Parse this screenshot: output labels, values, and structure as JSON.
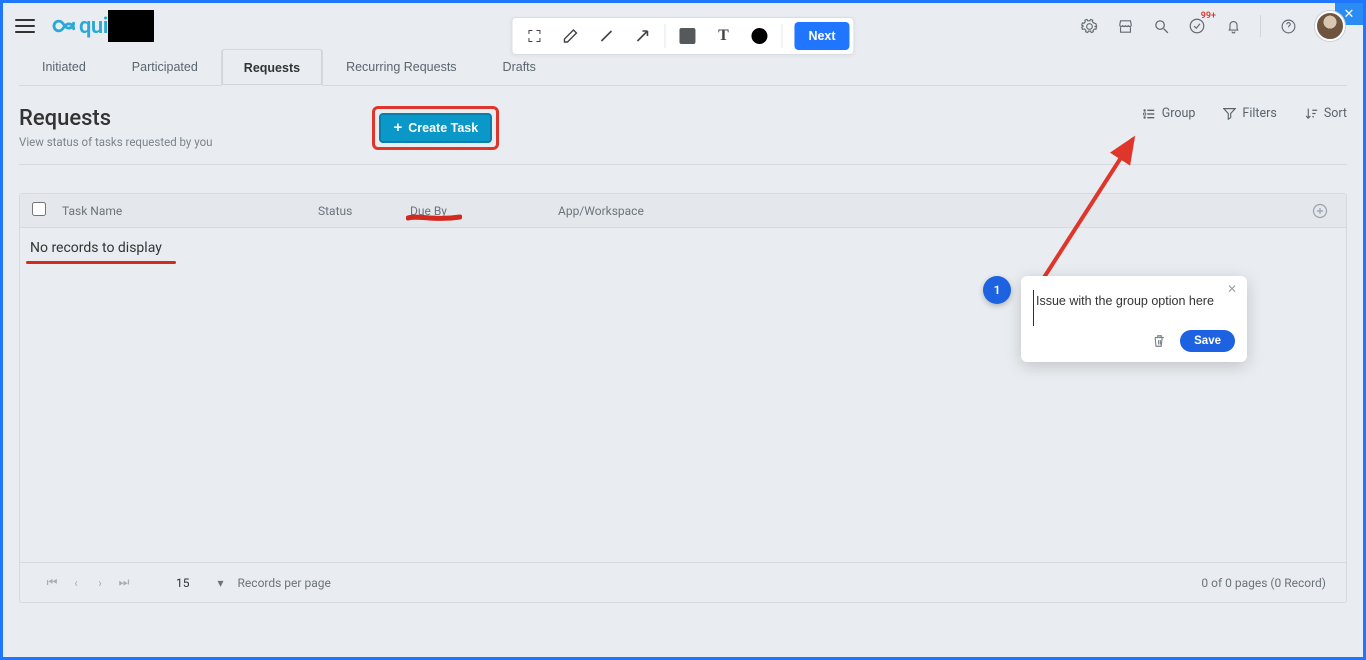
{
  "brand": {
    "name": "qui"
  },
  "toolbar": {
    "next": "Next"
  },
  "notifications": {
    "badge": "99+"
  },
  "tabs": [
    {
      "label": "Initiated"
    },
    {
      "label": "Participated"
    },
    {
      "label": "Requests",
      "active": true
    },
    {
      "label": "Recurring Requests"
    },
    {
      "label": "Drafts"
    }
  ],
  "page_header": {
    "title": "Requests",
    "subtitle": "View status of tasks requested by you",
    "create_label": "Create Task"
  },
  "header_actions": {
    "group": "Group",
    "filters": "Filters",
    "sort": "Sort"
  },
  "table": {
    "columns": {
      "task_name": "Task Name",
      "status": "Status",
      "due_by": "Due By",
      "app": "App/Workspace"
    },
    "empty_message": "No records to display"
  },
  "pager": {
    "page_size": "15",
    "per_page_label": "Records per page",
    "summary": "0 of 0 pages (0 Record)"
  },
  "annotation": {
    "index": "1",
    "text": "Issue with the group option here",
    "save": "Save"
  }
}
